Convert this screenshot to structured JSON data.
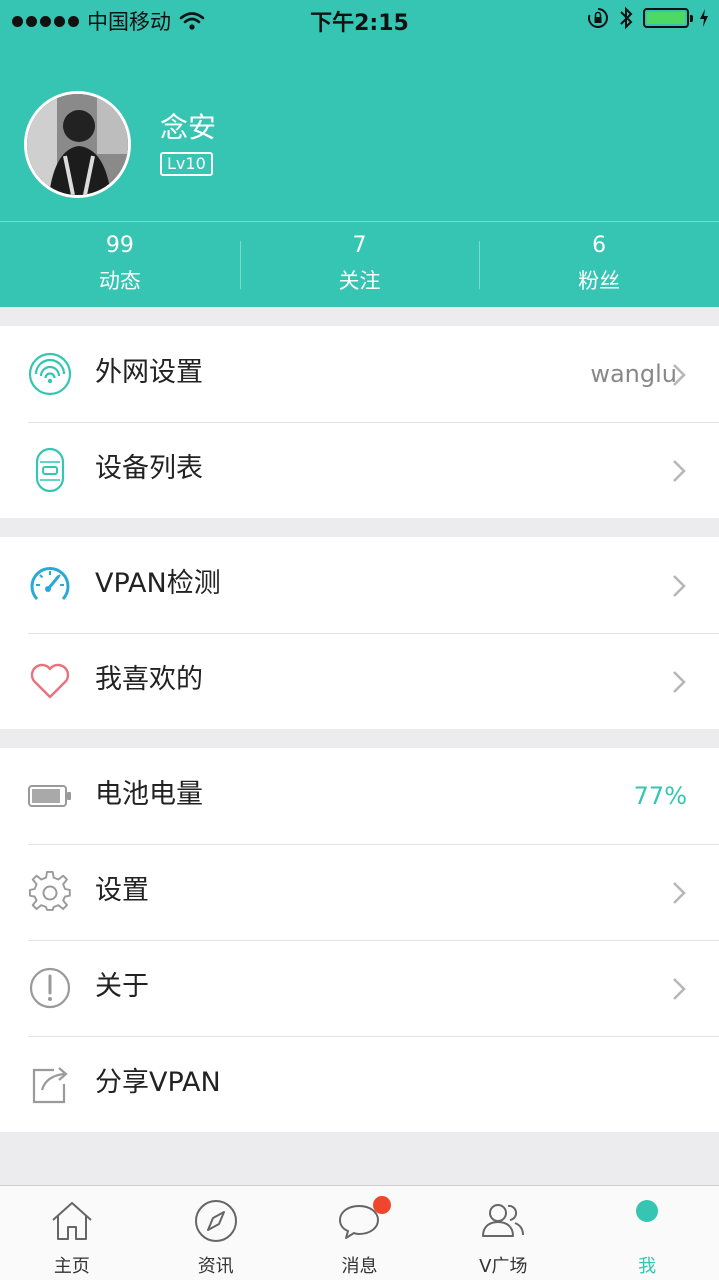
{
  "status_bar": {
    "carrier": "中国移动",
    "time": "下午2:15"
  },
  "profile": {
    "name": "念安",
    "level": "Lv10"
  },
  "stats": [
    {
      "value": "99",
      "label": "动态"
    },
    {
      "value": "7",
      "label": "关注"
    },
    {
      "value": "6",
      "label": "粉丝"
    }
  ],
  "menu": {
    "network": {
      "label": "外网设置",
      "value": "wanglu",
      "icon": "signal-icon"
    },
    "devices": {
      "label": "设备列表",
      "icon": "device-icon"
    },
    "detect": {
      "label": "VPAN检测",
      "icon": "speedometer-icon"
    },
    "favorites": {
      "label": "我喜欢的",
      "icon": "heart-icon"
    },
    "battery": {
      "label": "电池电量",
      "value": "77%",
      "icon": "battery-icon"
    },
    "settings": {
      "label": "设置",
      "icon": "gear-icon"
    },
    "about": {
      "label": "关于",
      "icon": "info-icon"
    },
    "share": {
      "label": "分享VPAN",
      "icon": "share-icon"
    }
  },
  "tabs": [
    {
      "label": "主页",
      "icon": "home-icon"
    },
    {
      "label": "资讯",
      "icon": "compass-icon"
    },
    {
      "label": "消息",
      "icon": "chat-icon"
    },
    {
      "label": "V广场",
      "icon": "people-icon"
    },
    {
      "label": "我",
      "icon": "me-icon"
    }
  ],
  "colors": {
    "accent": "#36c5b3",
    "badge": "#f0462d",
    "heart": "#e8717d",
    "speed": "#29a9d6"
  }
}
